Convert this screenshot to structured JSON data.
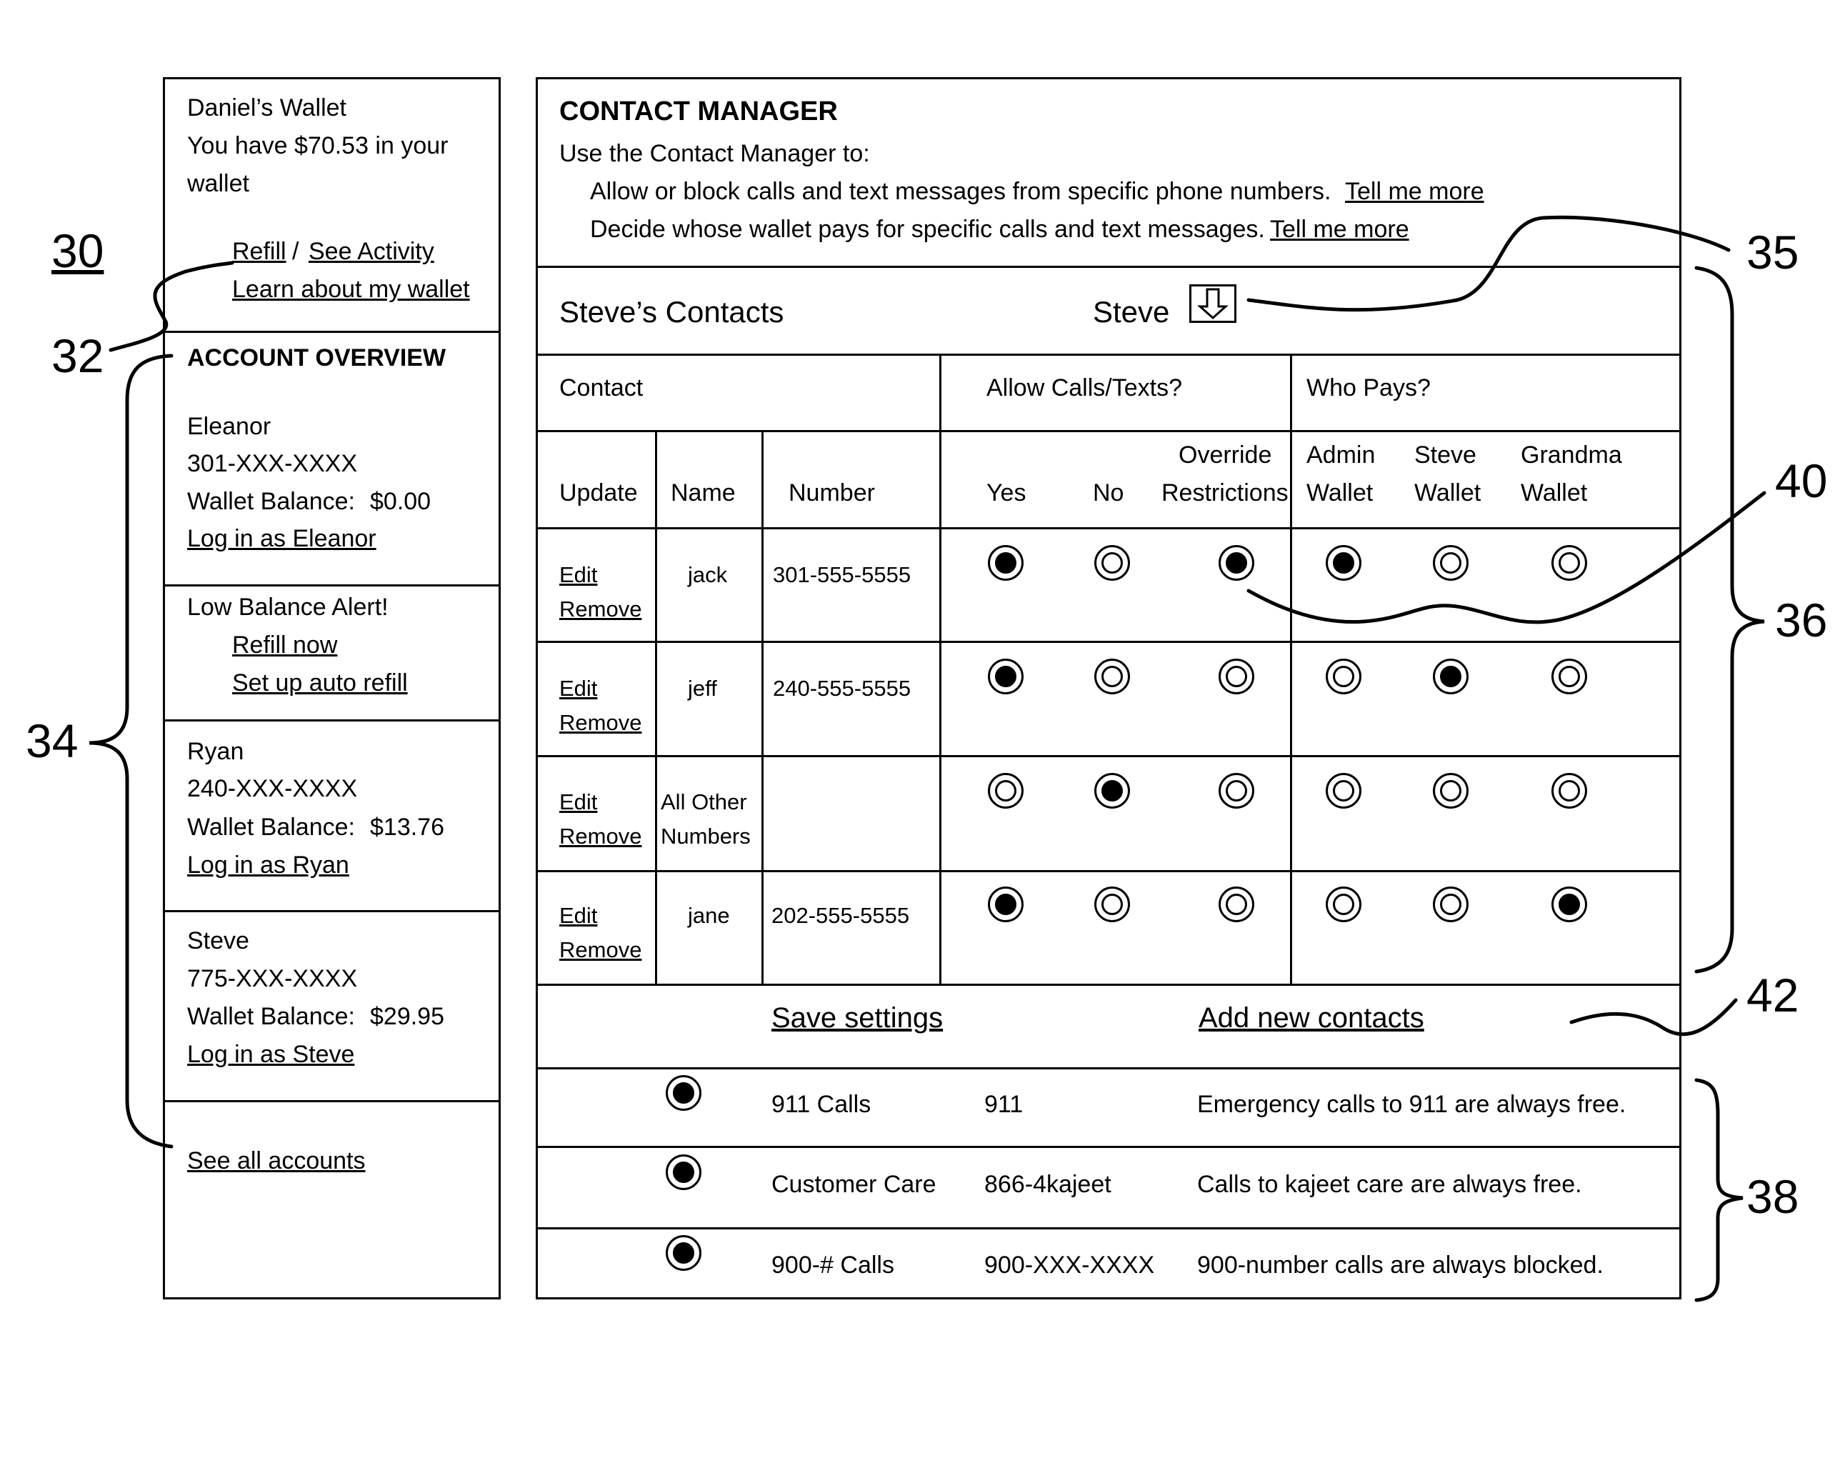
{
  "wallet_panel": {
    "title": "Daniel’s Wallet",
    "balance_line1": "You have $70.53 in your",
    "balance_line2": "wallet",
    "refill_link": "Refill",
    "separator": "/",
    "activity_link": "See Activity",
    "learn_link": "Learn about my wallet"
  },
  "account_overview": {
    "heading": "ACCOUNT OVERVIEW",
    "accounts": [
      {
        "name": "Eleanor",
        "phone": "301-XXX-XXXX",
        "balance_label": "Wallet Balance:",
        "balance": "$0.00",
        "login_link": "Log in as Eleanor"
      },
      {
        "name": "Ryan",
        "phone": "240-XXX-XXXX",
        "balance_label": "Wallet Balance:",
        "balance": "$13.76",
        "login_link": "Log in as Ryan"
      },
      {
        "name": "Steve",
        "phone": "775-XXX-XXXX",
        "balance_label": "Wallet Balance:",
        "balance": "$29.95",
        "login_link": "Log in as Steve"
      }
    ],
    "alert": {
      "title": "Low Balance Alert!",
      "refill_now": "Refill now",
      "auto_refill": "Set up auto refill"
    },
    "see_all": "See all accounts"
  },
  "contact_manager": {
    "title": "CONTACT MANAGER",
    "intro": "Use  the Contact Manager to:",
    "line1": "Allow or block calls and text messages from specific phone numbers.",
    "line2": "Decide whose wallet pays for specific calls and text messages.",
    "tell_more": "Tell me more",
    "contacts_title": "Steve’s Contacts",
    "selected_user": "Steve",
    "user_dropdown_icon": "down-arrow-icon",
    "group_headers": {
      "contact": "Contact",
      "allow": "Allow Calls/Texts?",
      "pays": "Who Pays?"
    },
    "col_headers": {
      "update": "Update",
      "name": "Name",
      "number": "Number",
      "yes": "Yes",
      "no": "No",
      "override_1": "Override",
      "override_2": "Restrictions",
      "admin_1": "Admin",
      "admin_2": "Wallet",
      "steve_1": "Steve",
      "steve_2": "Wallet",
      "grandma_1": "Grandma",
      "grandma_2": "Wallet"
    },
    "edit_label": "Edit",
    "remove_label": "Remove",
    "rows": [
      {
        "name": "jack",
        "name2": "",
        "number": "301-555-5555",
        "allow": "yes",
        "override": true,
        "payer": "admin"
      },
      {
        "name": "jeff",
        "name2": "",
        "number": "240-555-5555",
        "allow": "yes",
        "override": false,
        "payer": "steve"
      },
      {
        "name": "All Other",
        "name2": "Numbers",
        "number": "",
        "allow": "no",
        "override": false,
        "payer": "none"
      },
      {
        "name": "jane",
        "name2": "",
        "number": "202-555-5555",
        "allow": "yes",
        "override": false,
        "payer": "grandma"
      }
    ],
    "save_settings": "Save settings",
    "add_contacts": "Add new contacts",
    "fixed_rules": [
      {
        "label": "911 Calls",
        "number": "911",
        "note": "Emergency calls to 911 are always free.",
        "selected": true
      },
      {
        "label": "Customer Care",
        "number": "866-4kajeet",
        "note": "Calls to kajeet care are always free.",
        "selected": true
      },
      {
        "label": "900-# Calls",
        "number": "900-XXX-XXXX",
        "note": "900-number calls are always blocked.",
        "selected": true
      }
    ]
  },
  "reference_numerals": {
    "r30": "30",
    "r32": "32",
    "r34": "34",
    "r35": "35",
    "r36": "36",
    "r38": "38",
    "r40": "40",
    "r42": "42"
  }
}
